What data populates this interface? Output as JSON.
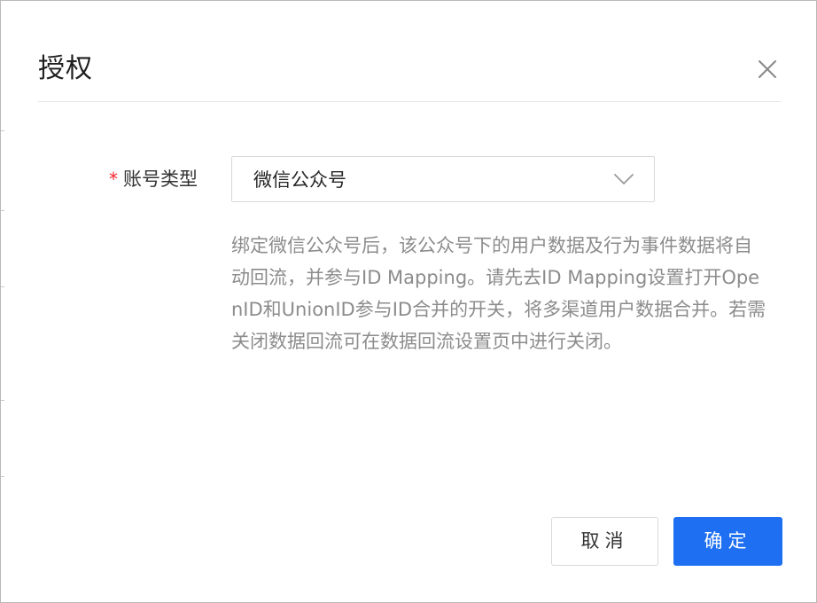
{
  "modal": {
    "title": "授权",
    "close_icon": "close-icon"
  },
  "form": {
    "account_type": {
      "required_mark": "*",
      "label": "账号类型",
      "selected_value": "微信公众号",
      "arrow_icon": "chevron-down-icon"
    },
    "hint": "绑定微信公众号后，该公众号下的用户数据及行为事件数据将自动回流，并参与ID Mapping。请先去ID Mapping设置打开OpenID和UnionID参与ID合并的开关，将多渠道用户数据合并。若需关闭数据回流可在数据回流设置页中进行关闭。"
  },
  "footer": {
    "cancel_label": "取消",
    "ok_label": "确定"
  },
  "colors": {
    "primary": "#1e6ff1",
    "required": "#f5222d",
    "hint_text": "#8c8c8c"
  }
}
